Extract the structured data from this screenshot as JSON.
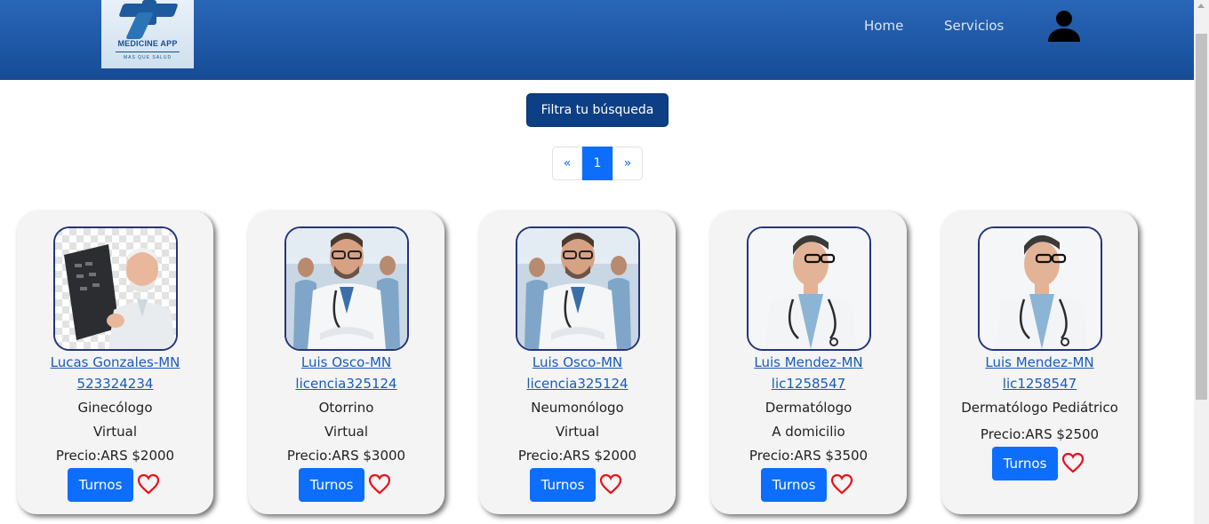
{
  "header": {
    "logo": {
      "brand": "MEDICINE APP",
      "tagline": "MAS QUE SALUD"
    },
    "nav": [
      {
        "label": "Home"
      },
      {
        "label": "Servicios"
      }
    ],
    "user_icon": "user-icon"
  },
  "filter": {
    "label": "Filtra tu búsqueda"
  },
  "pagination": {
    "prev": "«",
    "current": "1",
    "next": "»"
  },
  "doctors": [
    {
      "name_line1": "Lucas Gonzales-MN",
      "name_line2": "523324234",
      "specialty": "Ginecólogo",
      "modality": "Virtual",
      "price": "Precio:ARS $2000",
      "button": "Turnos",
      "photo": "older-doctor-xray"
    },
    {
      "name_line1": "Luis Osco-MN",
      "name_line2": "licencia325124",
      "specialty": "Otorrino",
      "modality": "Virtual",
      "price": "Precio:ARS $3000",
      "button": "Turnos",
      "photo": "doctor-hospital-team"
    },
    {
      "name_line1": "Luis Osco-MN",
      "name_line2": "licencia325124",
      "specialty": "Neumonólogo",
      "modality": "Virtual",
      "price": "Precio:ARS $2000",
      "button": "Turnos",
      "photo": "doctor-hospital-team"
    },
    {
      "name_line1": "Luis Mendez-MN",
      "name_line2": "lic1258547",
      "specialty": "Dermatólogo",
      "modality": "A domicilio",
      "price": "Precio:ARS $3500",
      "button": "Turnos",
      "photo": "doctor-profile-glasses"
    },
    {
      "name_line1": "Luis Mendez-MN",
      "name_line2": "lic1258547",
      "specialty": "Dermatólogo Pediátrico",
      "modality": "",
      "price": "Precio:ARS $2500",
      "button": "Turnos",
      "photo": "doctor-profile-glasses"
    }
  ],
  "colors": {
    "navbar": "#1e58a6",
    "primary_button": "#0d6efd",
    "filter_button": "#0d3f86",
    "heart": "#e8101a",
    "card_border": "#23357a"
  }
}
